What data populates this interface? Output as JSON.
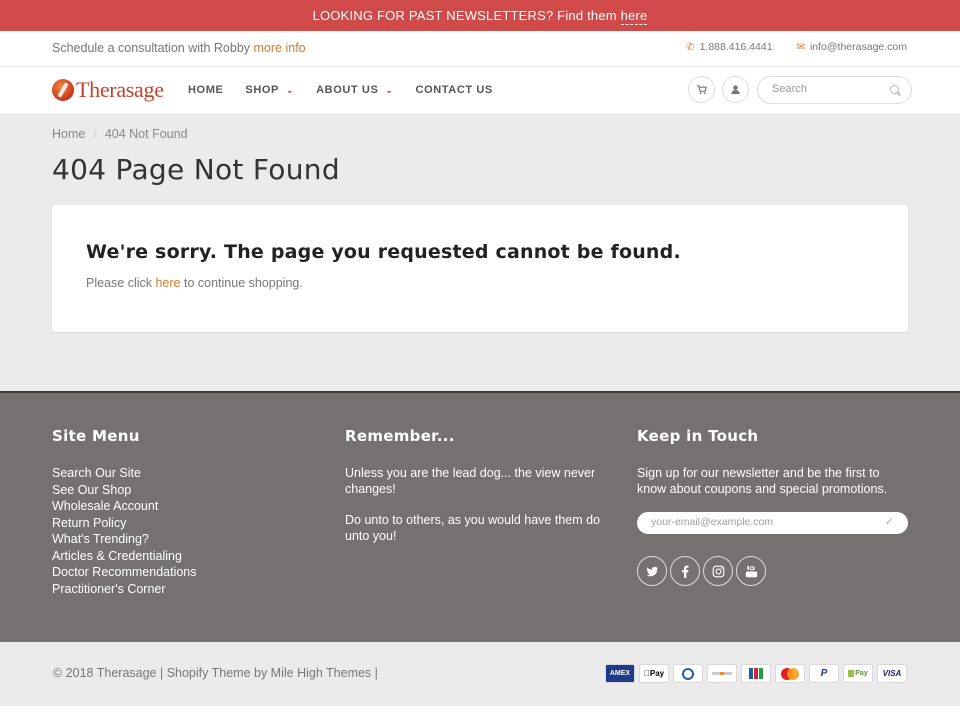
{
  "announcement": {
    "text": "LOOKING FOR PAST NEWSLETTERS? Find them ",
    "link": "here"
  },
  "utility": {
    "left_text": "Schedule a consultation with Robby ",
    "left_link": "more info",
    "phone": "1.888.416.4441",
    "email": "info@therasage.com"
  },
  "header": {
    "logo_text": "Therasage",
    "nav": [
      {
        "label": "HOME",
        "dropdown": false
      },
      {
        "label": "SHOP",
        "dropdown": true
      },
      {
        "label": "ABOUT US",
        "dropdown": true
      },
      {
        "label": "CONTACT US",
        "dropdown": false
      }
    ],
    "search_placeholder": "Search",
    "icons": [
      "cart-icon",
      "user-icon",
      "search-icon"
    ]
  },
  "breadcrumb": {
    "home": "Home",
    "current": "404 Not Found"
  },
  "page_title": "404 Page Not Found",
  "card": {
    "heading": "We're sorry. The page you requested cannot be found.",
    "msg_before": "Please click ",
    "msg_link": "here",
    "msg_after": " to continue shopping."
  },
  "footer": {
    "site_menu": {
      "title": "Site Menu",
      "links": [
        "Search Our Site",
        "See Our Shop",
        "Wholesale Account",
        "Return Policy",
        "What's Trending?",
        "Articles & Credentialing",
        "Doctor Recommendations",
        "Practitioner's Corner"
      ]
    },
    "remember": {
      "title": "Remember...",
      "p1": "Unless you are the lead dog... the view never changes!",
      "p2": "Do unto to others, as you would have them do unto you!"
    },
    "keep_in_touch": {
      "title": "Keep in Touch",
      "text": "Sign up for our newsletter and be the first to know about coupons and special promotions.",
      "email_placeholder": "your-email@example.com",
      "socials": [
        "twitter-icon",
        "facebook-icon",
        "instagram-icon",
        "youtube-icon"
      ]
    }
  },
  "bottom": {
    "copyright": "© 2018 Therasage | Shopify Theme by Mile High Themes |",
    "payments": [
      {
        "name": "american-express-icon",
        "label": "AMEX"
      },
      {
        "name": "apple-pay-icon",
        "label": " Pay"
      },
      {
        "name": "diners-club-icon",
        "label": ""
      },
      {
        "name": "discover-icon",
        "label": ""
      },
      {
        "name": "jcb-icon",
        "label": ""
      },
      {
        "name": "mastercard-icon",
        "label": ""
      },
      {
        "name": "paypal-icon",
        "label": "P"
      },
      {
        "name": "shopify-pay-icon",
        "label": "Pay"
      },
      {
        "name": "visa-icon",
        "label": "VISA"
      }
    ]
  },
  "colors": {
    "accent": "#d9782d",
    "announcement_bg": "#cf4a48",
    "footer_bg": "#747170",
    "main_bg": "#ebebeb"
  }
}
